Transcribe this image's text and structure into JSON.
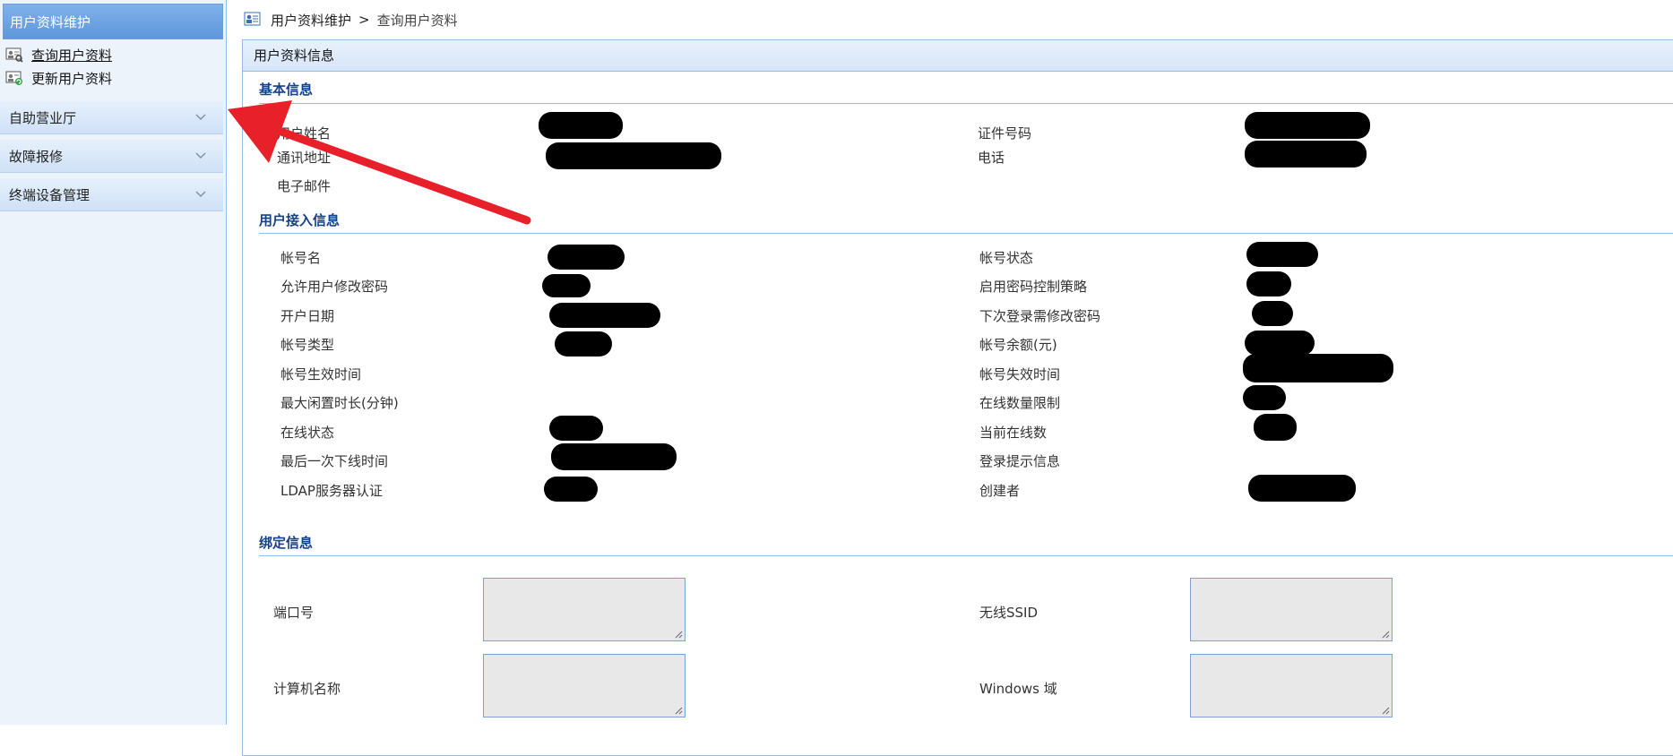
{
  "sidebar": {
    "header": "用户资料维护",
    "items": [
      {
        "label": "查询用户资料",
        "icon": "user-card-search-icon",
        "current": true
      },
      {
        "label": "更新用户资料",
        "icon": "user-card-refresh-icon",
        "current": false
      }
    ],
    "sections": [
      {
        "label": "自助营业厅"
      },
      {
        "label": "故障报修"
      },
      {
        "label": "终端设备管理"
      }
    ]
  },
  "breadcrumb": {
    "icon": "user-card-icon",
    "parent": "用户资料维护",
    "separator": ">",
    "current": "查询用户资料"
  },
  "panel": {
    "title": "用户资料信息",
    "basic": {
      "title": "基本信息",
      "fields": [
        {
          "label": "用户姓名"
        },
        {
          "label": "证件号码"
        },
        {
          "label": "通讯地址"
        },
        {
          "label": "电话"
        },
        {
          "label": "电子邮件"
        }
      ]
    },
    "access": {
      "title": "用户接入信息",
      "left": [
        {
          "label": "帐号名"
        },
        {
          "label": "允许用户修改密码"
        },
        {
          "label": "开户日期"
        },
        {
          "label": "帐号类型"
        },
        {
          "label": "帐号生效时间"
        },
        {
          "label": "最大闲置时长(分钟)"
        },
        {
          "label": "在线状态"
        },
        {
          "label": "最后一次下线时间"
        },
        {
          "label": "LDAP服务器认证"
        }
      ],
      "right": [
        {
          "label": "帐号状态"
        },
        {
          "label": "启用密码控制策略"
        },
        {
          "label": "下次登录需修改密码"
        },
        {
          "label": "帐号余额(元)"
        },
        {
          "label": "帐号失效时间"
        },
        {
          "label": "在线数量限制"
        },
        {
          "label": "当前在线数"
        },
        {
          "label": "登录提示信息"
        },
        {
          "label": "创建者"
        }
      ]
    },
    "binding": {
      "title": "绑定信息",
      "fields": [
        {
          "label": "端口号",
          "value": ""
        },
        {
          "label": "无线SSID",
          "value": ""
        },
        {
          "label": "计算机名称",
          "value": ""
        },
        {
          "label": "Windows 域",
          "value": ""
        }
      ]
    }
  },
  "colors": {
    "accent": "#15428b",
    "border": "#99bbe8",
    "sidebar_bg": "#ecf3fb",
    "annotation_arrow": "#e8202a",
    "redaction": "#000000"
  }
}
